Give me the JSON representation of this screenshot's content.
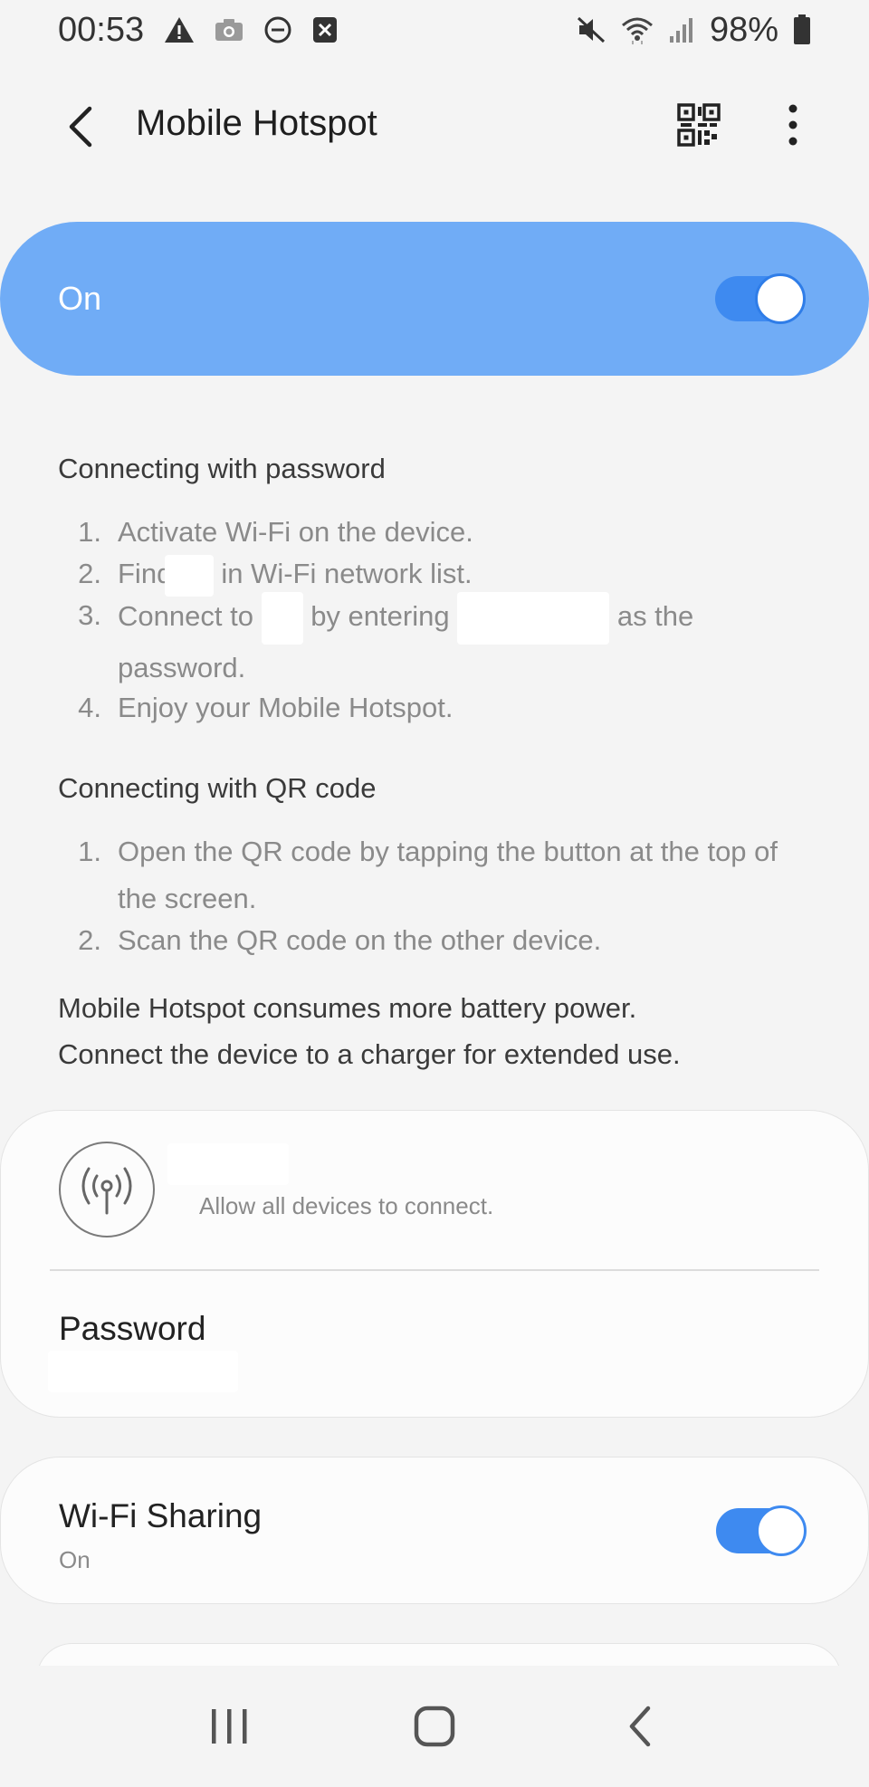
{
  "status_bar": {
    "time": "00:53",
    "battery": "98%",
    "icons": [
      "warning-icon",
      "camera-icon",
      "do-not-disturb-icon",
      "close-box-icon",
      "mute-icon",
      "wifi-icon",
      "signal-icon",
      "battery-icon"
    ]
  },
  "app_bar": {
    "title": "Mobile Hotspot",
    "icons": [
      "back-arrow-icon",
      "qr-code-icon",
      "more-vert-icon"
    ]
  },
  "master_switch": {
    "label": "On",
    "state": true,
    "accent": "#70acf6"
  },
  "password_section": {
    "title": "Connecting with password",
    "steps": [
      {
        "num": "1.",
        "text": "Activate Wi-Fi on the device."
      },
      {
        "num": "2.",
        "pre": "Find",
        "post": "in Wi-Fi network list."
      },
      {
        "num": "3.",
        "pre": "Connect to",
        "mid": "by entering",
        "post": "as the password."
      },
      {
        "num": "4.",
        "text": "Enjoy your Mobile Hotspot."
      }
    ]
  },
  "qr_section": {
    "title": "Connecting with QR code",
    "steps": [
      {
        "num": "1.",
        "text": "Open the QR code by tapping the button at the top of the screen."
      },
      {
        "num": "2.",
        "text": "Scan the QR code on the other device."
      }
    ]
  },
  "note": {
    "line1": "Mobile Hotspot consumes more battery power.",
    "line2": "Connect the device to a charger for extended use."
  },
  "network_card": {
    "subtitle": "Allow all devices to connect.",
    "password_label": "Password",
    "icon": "hotspot-antenna-icon"
  },
  "wifi_sharing": {
    "label": "Wi-Fi Sharing",
    "status": "On",
    "state": true
  },
  "nav_bar": {
    "icons": [
      "recents-icon",
      "home-icon",
      "back-icon"
    ]
  }
}
